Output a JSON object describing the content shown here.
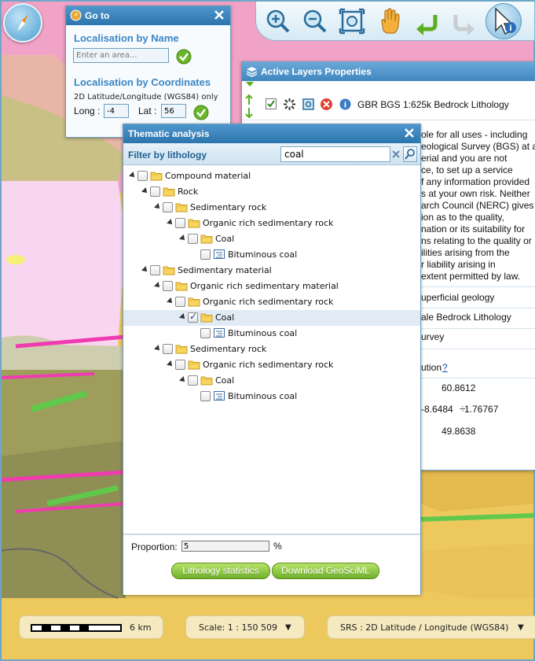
{
  "goto": {
    "title": "Go to",
    "by_name_heading": "Localisation by Name",
    "area_placeholder": "Enter an area...",
    "by_coords_heading": "Localisation by Coordinates",
    "coords_note": "2D Latitude/Longitude (WGS84) only",
    "long_label": "Long :",
    "long_value": "-4",
    "lat_label": "Lat :",
    "lat_value": "56"
  },
  "active_layers": {
    "title": "Active Layers Properties",
    "layer_name": "GBR BGS 1:625k Bedrock Lithology",
    "disclaimer_lines": [
      "ole for all uses - including",
      "eological Survey (BGS) at all",
      "erial and you are not",
      "ce, to set up a service",
      "f any information provided",
      "s at your own risk. Neither",
      "arch Council (NERC) gives",
      "ion as to the quality,",
      "nation or its suitability for",
      "ns relating to the quality or",
      "ilities arising from the",
      "r liability arising in",
      "extent permitted by law."
    ],
    "row_superficial": "uperficial geology",
    "row_bedrock": "ale Bedrock Lithology",
    "row_survey": "urvey",
    "row_ution": "ution",
    "help_link": "?",
    "bbox_north": "60.8612",
    "bbox_west": "-8.6484",
    "bbox_east": "1.76767",
    "bbox_south": "49.8638"
  },
  "thematic": {
    "title": "Thematic analysis",
    "filter_label": "Filter by lithology",
    "filter_value": "coal",
    "tree": [
      {
        "label": "Compound material",
        "level": 0,
        "type": "folder",
        "checked": false
      },
      {
        "label": "Rock",
        "level": 1,
        "type": "folder",
        "checked": false
      },
      {
        "label": "Sedimentary rock",
        "level": 2,
        "type": "folder",
        "checked": false
      },
      {
        "label": "Organic rich sedimentary rock",
        "level": 3,
        "type": "folder",
        "checked": false
      },
      {
        "label": "Coal",
        "level": 4,
        "type": "folder",
        "checked": false
      },
      {
        "label": "Bituminous coal",
        "level": 5,
        "type": "leaf",
        "checked": false
      },
      {
        "label": "Sedimentary material",
        "level": 1,
        "type": "folder",
        "checked": false
      },
      {
        "label": "Organic rich sedimentary material",
        "level": 2,
        "type": "folder",
        "checked": false
      },
      {
        "label": "Organic rich sedimentary rock",
        "level": 3,
        "type": "folder",
        "checked": false
      },
      {
        "label": "Coal",
        "level": 4,
        "type": "folder",
        "checked": true,
        "selected": true
      },
      {
        "label": "Bituminous coal",
        "level": 5,
        "type": "leaf",
        "checked": false
      },
      {
        "label": "Sedimentary rock",
        "level": 2,
        "type": "folder",
        "checked": false
      },
      {
        "label": "Organic rich sedimentary rock",
        "level": 3,
        "type": "folder",
        "checked": false
      },
      {
        "label": "Coal",
        "level": 4,
        "type": "folder",
        "checked": false
      },
      {
        "label": "Bituminous coal",
        "level": 5,
        "type": "leaf",
        "checked": false
      }
    ],
    "proportion_label": "Proportion:",
    "proportion_value": "5",
    "proportion_unit": "%",
    "btn_statistics": "Lithology statistics",
    "btn_download": "Download GeoSciML"
  },
  "statusbar": {
    "scale_bar_label": "6 km",
    "scale_label": "Scale: 1 : 150 509",
    "srs_label": "SRS : 2D Latitude / Longitude (WGS84)"
  },
  "colors": {
    "panel_title": "#2c74ad",
    "heading_blue": "#3b86c5",
    "button_green": "#70b128",
    "map_pink": "#f2a6c7",
    "map_olive": "#9b9a5b",
    "map_yellow": "#ecc85d"
  }
}
